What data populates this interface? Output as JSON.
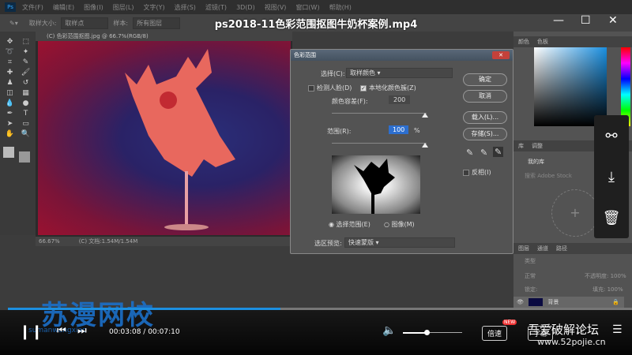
{
  "video": {
    "title": "ps2018-11色彩范围抠图牛奶杯案例.mp4",
    "current_time": "00:03:08",
    "duration": "00:07:10",
    "progress": 0.437,
    "volume": 0.4,
    "speed_label": "倍速",
    "speed_badge": "NEW",
    "subtitle_label": "字幕",
    "brand": "苏漫网校",
    "brand_sub": "sumanwangxiao",
    "watermark_title": "吾爱破解论坛",
    "watermark_url": "www.52pojie.cn",
    "accent": "#1c8fe0"
  },
  "ps": {
    "menu": [
      "文件(F)",
      "编辑(E)",
      "图像(I)",
      "图层(L)",
      "文字(Y)",
      "选择(S)",
      "滤镜(T)",
      "3D(D)",
      "视图(V)",
      "窗口(W)",
      "帮助(H)"
    ],
    "options": {
      "sample_size_label": "取样大小:",
      "sample_size": "取样点",
      "sample_label": "样本:",
      "sample": "所有图层"
    },
    "doc_tab": "(C) 色彩范围抠图.jpg @ 66.7%(RGB/8)",
    "status_zoom": "66.67%",
    "status_doc": "(C) 文档:1.54M/1.54M",
    "dialog": {
      "title": "色彩范围",
      "select_label": "选择(C):",
      "select_value": "取样颜色",
      "detect_faces": "检测人脸(D)",
      "localized": "本地化颜色簇(Z)",
      "fuzziness_label": "颜色容差(F):",
      "fuzziness": "200",
      "range_label": "范围(R):",
      "range": "100",
      "range_unit": "%",
      "ok": "确定",
      "cancel": "取消",
      "load": "载入(L)...",
      "save": "存储(S)...",
      "invert": "反相(I)",
      "radio_selection": "选择范围(E)",
      "radio_image": "图像(M)",
      "preview_label": "选区预览:",
      "preview_value": "快速蒙版"
    },
    "panels": {
      "color_tabs": [
        "颜色",
        "色板"
      ],
      "lib_tabs": [
        "库",
        "调整"
      ],
      "lib_name": "我的库",
      "lib_search": "搜索 Adobe Stock",
      "layer_tabs": [
        "图层",
        "通道",
        "路径"
      ],
      "layer_kind": "类型",
      "blend": "正常",
      "opacity_label": "不透明度:",
      "opacity": "100%",
      "lock_label": "锁定:",
      "fill_label": "填充:",
      "fill": "100%",
      "layer_name": "背景"
    }
  }
}
